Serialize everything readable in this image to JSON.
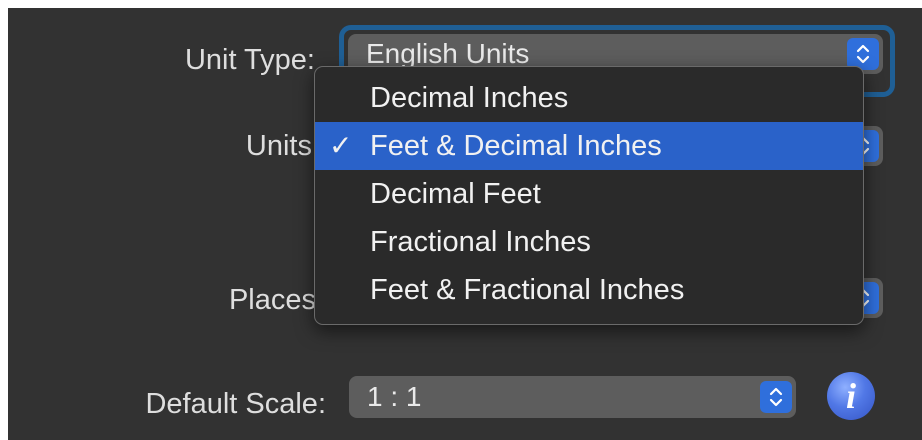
{
  "unit_type": {
    "label": "Unit Type:",
    "value": "English Units"
  },
  "units": {
    "label": "Units"
  },
  "places": {
    "label": "Places"
  },
  "default_scale": {
    "label": "Default Scale:",
    "value": "1 : 1"
  },
  "units_menu": {
    "items": [
      {
        "label": "Decimal Inches",
        "selected": false
      },
      {
        "label": "Feet & Decimal Inches",
        "selected": true
      },
      {
        "label": "Decimal Feet",
        "selected": false
      },
      {
        "label": "Fractional Inches",
        "selected": false
      },
      {
        "label": "Feet & Fractional Inches",
        "selected": false
      }
    ],
    "checkmark": "✓"
  },
  "info_button": {
    "glyph": "i",
    "icon": "info-icon"
  },
  "colors": {
    "panel_bg": "#323232",
    "accent": "#2a62c9",
    "focus_ring": "#1f5f95"
  }
}
